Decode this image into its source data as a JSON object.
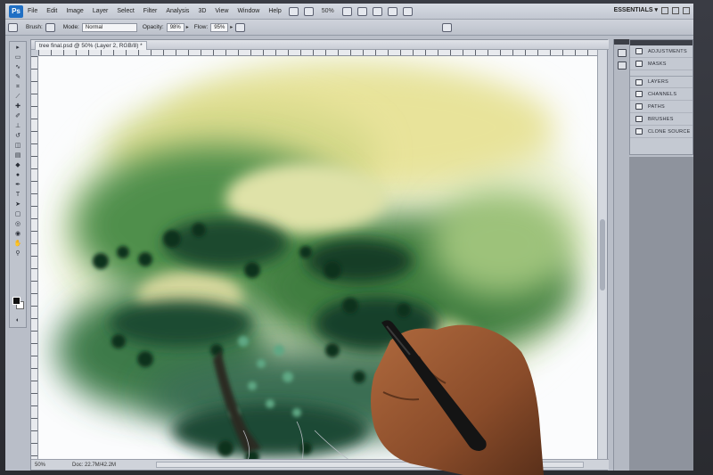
{
  "menubar": {
    "logo": "Ps",
    "items": [
      "File",
      "Edit",
      "Image",
      "Layer",
      "Select",
      "Filter",
      "Analysis",
      "3D",
      "View",
      "Window",
      "Help"
    ],
    "zoom": "50%",
    "workspace": "ESSENTIALS ▾"
  },
  "options": {
    "brush_label": "Brush:",
    "mode_label": "Mode:",
    "mode_value": "Normal",
    "opacity_label": "Opacity:",
    "opacity_value": "98%",
    "flow_label": "Flow:",
    "flow_value": "95%"
  },
  "document": {
    "tab_title": "tree final.psd @ 50% (Layer 2, RGB/8) *",
    "status_zoom": "50%",
    "status_doc": "Doc: 22.7M/42.2M"
  },
  "panels": {
    "group1": [
      "ADJUSTMENTS",
      "MASKS"
    ],
    "group2": [
      "LAYERS",
      "CHANNELS",
      "PATHS",
      "BRUSHES",
      "CLONE SOURCE"
    ]
  },
  "colors": {
    "foreground": "#111111",
    "background": "#ffffff",
    "ps_blue": "#1f6fc4"
  }
}
